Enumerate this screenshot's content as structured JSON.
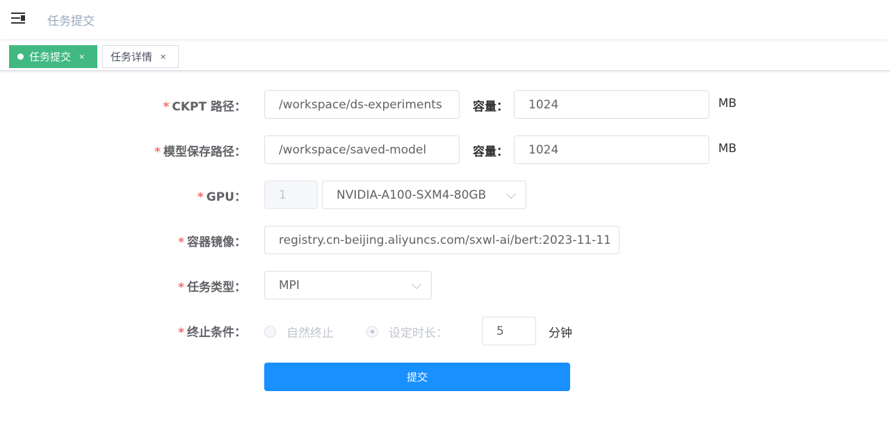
{
  "navbar": {
    "menu_icon": "hamburger-fold-icon",
    "breadcrumb": "任务提交"
  },
  "tags": [
    {
      "label": "任务提交",
      "close": "×",
      "active": true
    },
    {
      "label": "任务详情",
      "close": "×",
      "active": false
    }
  ],
  "form": {
    "ckpt": {
      "label": "CKPT 路径：",
      "value": "/workspace/ds-experiments",
      "capacity_label": "容量：",
      "capacity_value": "1024",
      "unit": "MB"
    },
    "model_save": {
      "label": "模型保存路径：",
      "value": "/workspace/saved-model",
      "capacity_label": "容量：",
      "capacity_value": "1024",
      "unit": "MB"
    },
    "gpu": {
      "label": "GPU：",
      "count": "1",
      "model": "NVIDIA-A100-SXM4-80GB"
    },
    "image": {
      "label": "容器镜像：",
      "value": "registry.cn-beijing.aliyuncs.com/sxwl-ai/bert:2023-11-11"
    },
    "task_type": {
      "label": "任务类型：",
      "value": "MPI"
    },
    "stop_condition": {
      "label": "终止条件：",
      "option_natural": "自然终止",
      "option_duration": "设定时长：",
      "selected": "设定时长",
      "duration_value": "5",
      "duration_unit": "分钟"
    },
    "required_mark": "*",
    "submit_label": "提交"
  }
}
